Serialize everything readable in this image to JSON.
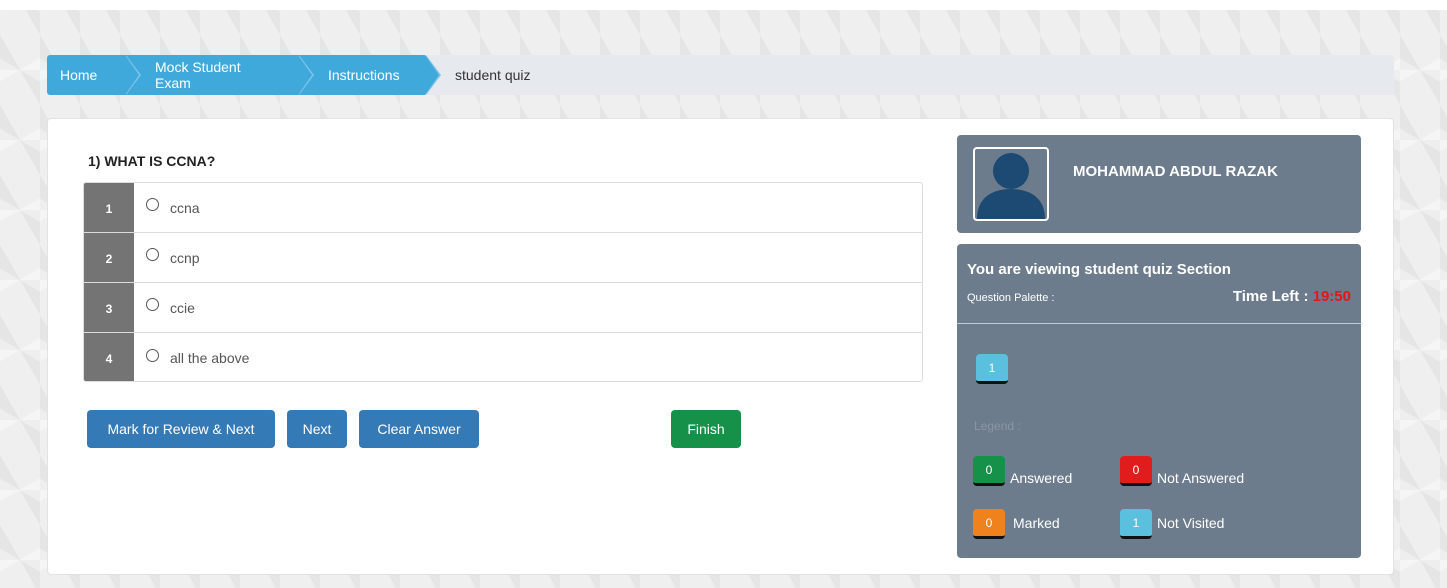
{
  "breadcrumb": {
    "items": [
      "Home",
      "Mock Student Exam",
      "Instructions"
    ],
    "current": "student quiz"
  },
  "question": {
    "title": "1) WHAT IS CCNA?",
    "options": [
      {
        "num": "1",
        "label": "ccna"
      },
      {
        "num": "2",
        "label": "ccnp"
      },
      {
        "num": "3",
        "label": "ccie"
      },
      {
        "num": "4",
        "label": "all the above"
      }
    ]
  },
  "actions": {
    "mark_review": "Mark for Review & Next",
    "next": "Next",
    "clear": "Clear Answer",
    "finish": "Finish"
  },
  "profile": {
    "name": "MOHAMMAD ABDUL RAZAK"
  },
  "palette": {
    "section_title": "You are viewing student quiz Section",
    "label": "Question Palette :",
    "time_label": "Time Left :",
    "time_value": "19:50",
    "questions": [
      "1"
    ],
    "faded_text": "Legend :",
    "legend": [
      {
        "count": "0",
        "label": "Answered"
      },
      {
        "count": "0",
        "label": "Not Answered"
      },
      {
        "count": "0",
        "label": "Marked"
      },
      {
        "count": "1",
        "label": "Not Visited"
      }
    ]
  },
  "colors": {
    "breadcrumb": "#3fa9dc",
    "primary_button": "#337ab7",
    "finish_button": "#16914a",
    "panel": "#6d7c8c",
    "time_value": "#e8141a",
    "answered": "#16914a",
    "not_answered": "#e11c1c",
    "marked": "#f0821e",
    "not_visited": "#5bc0de"
  }
}
